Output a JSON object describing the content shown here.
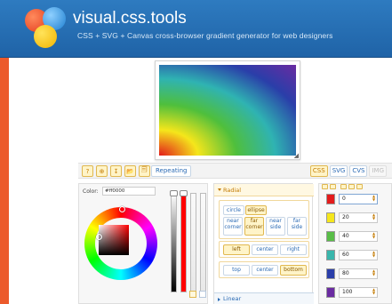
{
  "header": {
    "brand": "visual.css.tools",
    "tagline": "CSS + SVG + Canvas cross-browser gradient generator for web designers"
  },
  "toolbar": {
    "buttons": [
      "?",
      "⊕",
      "↧",
      "📂",
      "🗐"
    ],
    "repeating_label": "Repeating",
    "output_tabs": [
      "CSS",
      "SVG",
      "CVS",
      "IMG"
    ]
  },
  "color_picker": {
    "label": "Color:",
    "value": "#ff0000"
  },
  "radial": {
    "title": "Radial",
    "shape_options": [
      "circle",
      "ellipse"
    ],
    "size_options": [
      {
        "line1": "near",
        "line2": "corner"
      },
      {
        "line1": "far",
        "line2": "corner"
      },
      {
        "line1": "near",
        "line2": "side"
      },
      {
        "line1": "far",
        "line2": "side"
      }
    ],
    "horizontal_options": [
      "left",
      "center",
      "right"
    ],
    "vertical_options": [
      "top",
      "center",
      "bottom"
    ]
  },
  "linear": {
    "title": "Linear"
  },
  "stops": [
    {
      "color": "#e31b1b",
      "value": "0"
    },
    {
      "color": "#f5e61b",
      "value": "20"
    },
    {
      "color": "#58bd47",
      "value": "40"
    },
    {
      "color": "#39b6ac",
      "value": "60"
    },
    {
      "color": "#2a3ea9",
      "value": "80"
    },
    {
      "color": "#6a2ba1",
      "value": "100"
    }
  ],
  "colors": {
    "header_blue": "#2370b7",
    "accent_orange": "#ec5a2c",
    "active_yellow": "#fff4c8"
  }
}
